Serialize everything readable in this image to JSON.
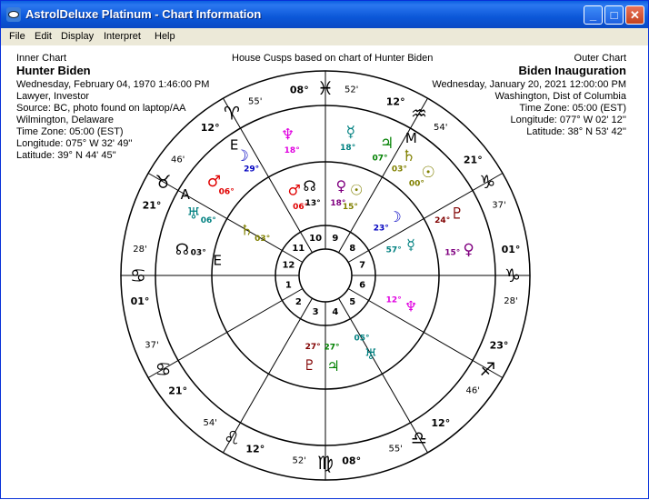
{
  "window": {
    "title": "AstrolDeluxe Platinum - Chart Information",
    "buttons": {
      "minimize": "_",
      "maximize": "□",
      "close": "✕"
    }
  },
  "menu": [
    "File",
    "Edit",
    "Display",
    "Interpret",
    "Help"
  ],
  "center_title": "House Cusps based on chart of Hunter Biden",
  "inner_chart": {
    "heading": "Inner Chart",
    "name": "Hunter Biden",
    "lines": [
      "Wednesday, February 04, 1970  1:46:00 PM",
      "Lawyer, Investor",
      "Source: BC, photo found on laptop/AA",
      "Wilmington, Delaware",
      "Time Zone: 05:00 (EST)",
      "Longitude: 075° W 32' 49''",
      "Latitude: 39° N 44' 45''"
    ]
  },
  "outer_chart": {
    "heading": "Outer Chart",
    "name": "Biden Inauguration",
    "lines": [
      "Wednesday, January 20, 2021  12:00:00 PM",
      "Washington, Dist of Columbia",
      "Time Zone: 05:00 (EST)",
      "Longitude: 077° W 02' 12''",
      "Latitude: 38° N 53' 42''"
    ]
  },
  "house_numbers": [
    "1",
    "2",
    "3",
    "4",
    "5",
    "6",
    "7",
    "8",
    "9",
    "10",
    "11",
    "12"
  ],
  "cusps": [
    {
      "deg": "08°",
      "min": "52'",
      "sign": "♓"
    },
    {
      "deg": "12°",
      "min": "54'",
      "sign": "♒"
    },
    {
      "deg": "21°",
      "min": "37'",
      "sign": "♑"
    },
    {
      "deg": "01°",
      "min": "28'",
      "sign": "♑"
    },
    {
      "deg": "23°",
      "min": "46'",
      "sign": "♐"
    },
    {
      "deg": "12°",
      "min": "55'",
      "sign": "♎"
    },
    {
      "deg": "08°",
      "min": "52'",
      "sign": "♍"
    },
    {
      "deg": "12°",
      "min": "54'",
      "sign": "♌"
    },
    {
      "deg": "21°",
      "min": "37'",
      "sign": "♋"
    },
    {
      "deg": "01°",
      "min": "28'",
      "sign": "♋"
    },
    {
      "deg": "21°",
      "min": "46'",
      "sign": "♉"
    },
    {
      "deg": "12°",
      "min": "55'",
      "sign": "♈"
    }
  ],
  "inner_planets": [
    {
      "glyph": "♄",
      "deg": "03°",
      "color": "#808000"
    },
    {
      "glyph": "♂",
      "deg": "06°",
      "color": "#e00000"
    },
    {
      "glyph": "☊",
      "deg": "13°",
      "color": "#000000"
    },
    {
      "glyph": "♀",
      "deg": "18°",
      "color": "#800080"
    },
    {
      "glyph": "☉",
      "deg": "15°",
      "color": "#808000"
    },
    {
      "glyph": "☽",
      "deg": "23°",
      "color": "#0000c0"
    },
    {
      "glyph": "♅",
      "deg": "05°",
      "color": "#008080"
    },
    {
      "glyph": "♃",
      "deg": "27°",
      "color": "#008000"
    },
    {
      "glyph": "♆",
      "deg": "12°",
      "color": "#e000e0"
    },
    {
      "glyph": "♇",
      "deg": "27°",
      "color": "#800000"
    },
    {
      "glyph": "☿",
      "deg": "57°",
      "color": "#008080"
    }
  ],
  "outer_planets": [
    {
      "glyph": "♆",
      "deg": "18°",
      "color": "#e000e0"
    },
    {
      "glyph": "☿",
      "deg": "18°",
      "color": "#008080"
    },
    {
      "glyph": "♃",
      "deg": "07°",
      "color": "#008000"
    },
    {
      "glyph": "♄",
      "deg": "03°",
      "color": "#808000"
    },
    {
      "glyph": "☉",
      "deg": "00°",
      "color": "#808000"
    },
    {
      "glyph": "♇",
      "deg": "24°",
      "color": "#800000"
    },
    {
      "glyph": "♀",
      "deg": "15°",
      "color": "#800080"
    },
    {
      "glyph": "☽",
      "deg": "29°",
      "color": "#0000c0"
    },
    {
      "glyph": "♂",
      "deg": "06°",
      "color": "#e00000"
    },
    {
      "glyph": "♅",
      "deg": "06°",
      "color": "#008080"
    },
    {
      "glyph": "☊",
      "deg": "03°",
      "color": "#000000"
    }
  ],
  "angles": {
    "asc": "A",
    "mc": "M",
    "e_left": "E",
    "e_right": "E"
  }
}
